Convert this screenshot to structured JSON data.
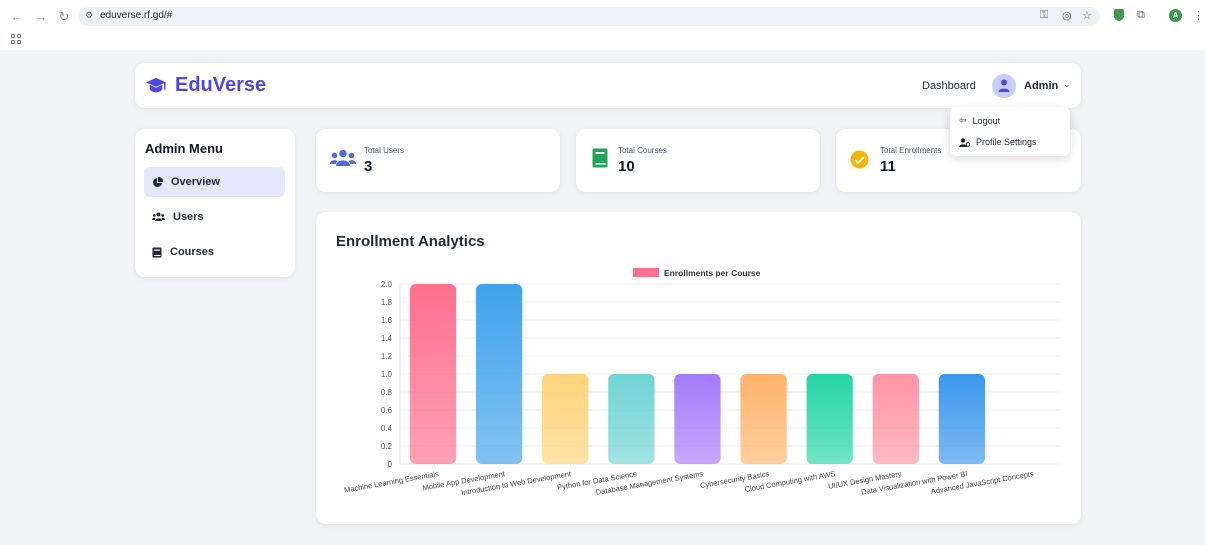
{
  "browser": {
    "url": "eduverse.rf.gd/#"
  },
  "header": {
    "brand": "EduVerse",
    "nav_dashboard": "Dashboard",
    "user_name": "Admin"
  },
  "dropdown": {
    "items": [
      {
        "label": "Logout",
        "icon": "logout-icon"
      },
      {
        "label": "Profile Settings",
        "icon": "user-gear-icon"
      }
    ]
  },
  "sidebar": {
    "title": "Admin Menu",
    "items": [
      {
        "label": "Overview",
        "icon": "pie-chart-icon",
        "active": true
      },
      {
        "label": "Users",
        "icon": "users-icon",
        "active": false
      },
      {
        "label": "Courses",
        "icon": "book-icon",
        "active": false
      }
    ]
  },
  "stats": [
    {
      "label": "Total Users",
      "value": "3",
      "icon": "users-icon",
      "color": "#4f6bdc"
    },
    {
      "label": "Total Courses",
      "value": "10",
      "icon": "book-icon",
      "color": "#22a55b"
    },
    {
      "label": "Total Enrollments",
      "value": "11",
      "icon": "check-circle-icon",
      "color": "#f2b705"
    }
  ],
  "chart": {
    "title": "Enrollment Analytics"
  },
  "chart_data": {
    "type": "bar",
    "legend": "Enrollments per Course",
    "legend_position": "top",
    "grid": true,
    "categories": [
      "Machine Learning Essentials",
      "Mobile App Development",
      "Introduction to Web Development",
      "Python for Data Science",
      "Database Management Systems",
      "Cybersecurity Basics",
      "Cloud Computing with AWS",
      "UI/UX Design Mastery",
      "Data Visualization with Power BI",
      "Advanced JavaScript Concepts"
    ],
    "series": [
      {
        "name": "Enrollments per Course",
        "values": [
          2,
          2,
          1,
          1,
          1,
          1,
          1,
          1,
          1,
          0
        ]
      }
    ],
    "colors": [
      "#ff6f8e",
      "#3fa2ec",
      "#ffd37a",
      "#6fd3d3",
      "#a37bfb",
      "#ffb36b",
      "#25d6a6",
      "#ff94a3",
      "#3a96ec",
      "#c9cbcf"
    ],
    "ylim": [
      0,
      2.0
    ],
    "yticks": [
      "0",
      "0.2",
      "0.4",
      "0.6",
      "0.8",
      "1.0",
      "1.2",
      "1.4",
      "1.6",
      "1.8",
      "2.0"
    ]
  }
}
